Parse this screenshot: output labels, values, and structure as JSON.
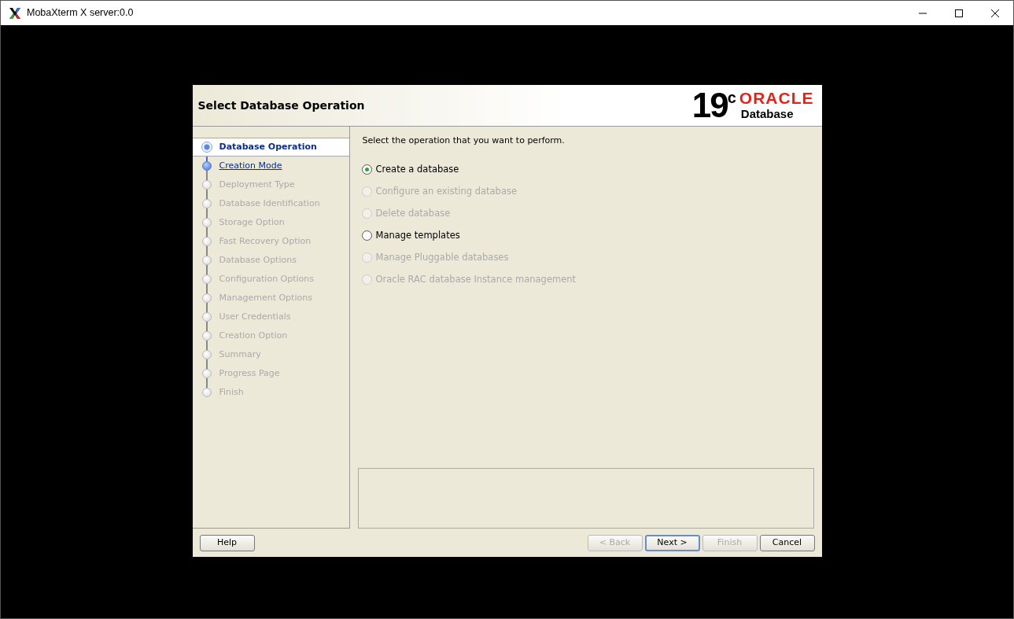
{
  "window": {
    "title": "MobaXterm X server:0.0"
  },
  "dialog": {
    "title": "Select Database Operation",
    "logo": {
      "version": "19",
      "version_suffix": "c",
      "brand": "ORACLE",
      "product": "Database"
    },
    "steps": [
      {
        "label": "Database Operation",
        "selected": true,
        "disabled": false
      },
      {
        "label": "Creation Mode",
        "selected": false,
        "disabled": false
      },
      {
        "label": "Deployment Type",
        "selected": false,
        "disabled": true
      },
      {
        "label": "Database Identification",
        "selected": false,
        "disabled": true
      },
      {
        "label": "Storage Option",
        "selected": false,
        "disabled": true
      },
      {
        "label": "Fast Recovery Option",
        "selected": false,
        "disabled": true
      },
      {
        "label": "Database Options",
        "selected": false,
        "disabled": true
      },
      {
        "label": "Configuration Options",
        "selected": false,
        "disabled": true
      },
      {
        "label": "Management Options",
        "selected": false,
        "disabled": true
      },
      {
        "label": "User Credentials",
        "selected": false,
        "disabled": true
      },
      {
        "label": "Creation Option",
        "selected": false,
        "disabled": true
      },
      {
        "label": "Summary",
        "selected": false,
        "disabled": true
      },
      {
        "label": "Progress Page",
        "selected": false,
        "disabled": true
      },
      {
        "label": "Finish",
        "selected": false,
        "disabled": true
      }
    ],
    "prompt": "Select the operation that you want to perform.",
    "options": [
      {
        "label": "Create a database",
        "selected": true,
        "disabled": false
      },
      {
        "label": "Configure an existing database",
        "selected": false,
        "disabled": true
      },
      {
        "label": "Delete database",
        "selected": false,
        "disabled": true
      },
      {
        "label": "Manage templates",
        "selected": false,
        "disabled": false
      },
      {
        "label": "Manage Pluggable databases",
        "selected": false,
        "disabled": true
      },
      {
        "label": "Oracle RAC database Instance management",
        "selected": false,
        "disabled": true
      }
    ],
    "buttons": [
      {
        "label": "Help",
        "disabled": false,
        "default": false
      },
      {
        "label": "< Back",
        "disabled": true,
        "default": false
      },
      {
        "label": "Next >",
        "disabled": false,
        "default": true
      },
      {
        "label": "Finish",
        "disabled": true,
        "default": false
      },
      {
        "label": "Cancel",
        "disabled": false,
        "default": false
      }
    ]
  }
}
